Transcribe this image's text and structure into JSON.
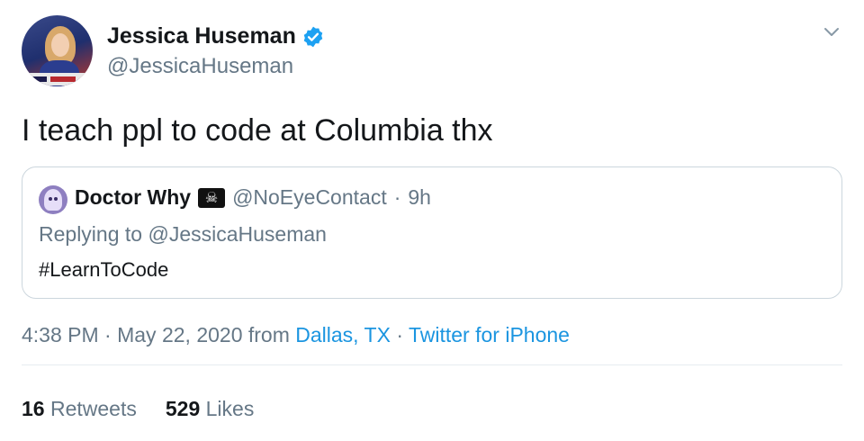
{
  "author": {
    "display_name": "Jessica Huseman",
    "handle": "@JessicaHuseman",
    "verified": true
  },
  "tweet": {
    "text": "I teach ppl to code at Columbia thx"
  },
  "quoted_tweet": {
    "display_name": "Doctor Why",
    "name_emoji": "☠",
    "handle": "@NoEyeContact",
    "separator": "·",
    "time_ago": "9h",
    "replying_prefix": "Replying to ",
    "replying_to": "@JessicaHuseman",
    "text": "#LearnToCode"
  },
  "meta": {
    "time": "4:38 PM",
    "dot1": "·",
    "date": "May 22, 2020",
    "from_word": "from",
    "location": "Dallas, TX",
    "dot2": "·",
    "client": "Twitter for iPhone"
  },
  "stats": {
    "retweets_count": "16",
    "retweets_label": "Retweets",
    "likes_count": "529",
    "likes_label": "Likes"
  },
  "icons": {
    "verified": "verified-badge-icon",
    "menu": "chevron-down-icon"
  },
  "colors": {
    "link": "#1b95e0",
    "secondary_text": "#657786",
    "primary_text": "#14171a",
    "verified_badge": "#1da1f2",
    "border": "#ccd6dd"
  }
}
